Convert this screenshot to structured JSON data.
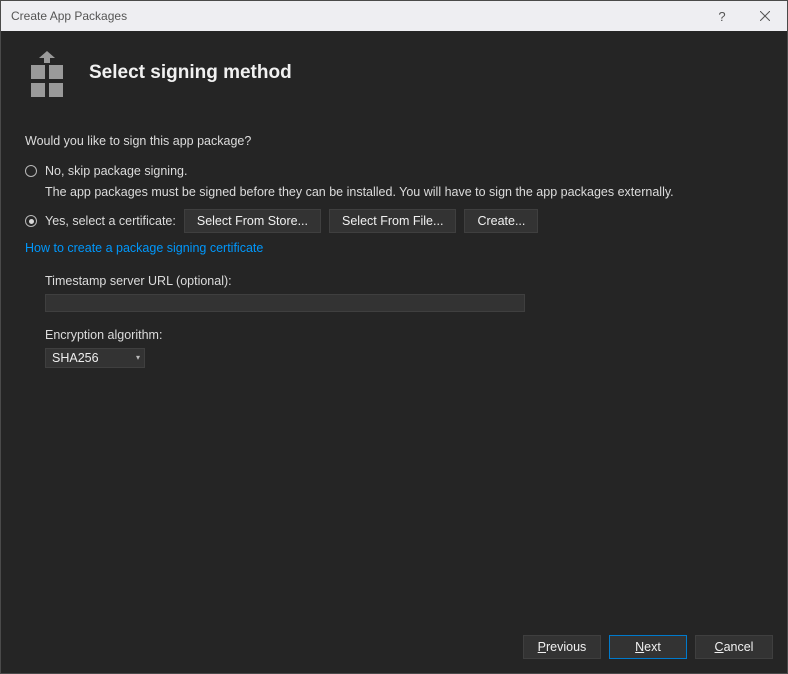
{
  "window": {
    "title": "Create App Packages"
  },
  "header": {
    "title": "Select signing method"
  },
  "prompt": "Would you like to sign this app package?",
  "options": {
    "no_label": "No, skip package signing.",
    "no_subtext": "The app packages must be signed before they can be installed. You will have to sign the app packages externally.",
    "yes_label": "Yes, select a certificate:",
    "select_store": "Select From Store...",
    "select_file": "Select From File...",
    "create": "Create..."
  },
  "link": "How to create a package signing certificate",
  "timestamp": {
    "label": "Timestamp server URL (optional):",
    "value": ""
  },
  "encryption": {
    "label": "Encryption algorithm:",
    "value": "SHA256"
  },
  "buttons": {
    "previous": "Previous",
    "previous_mnemonic": "P",
    "next": "Next",
    "next_mnemonic": "N",
    "cancel": "Cancel",
    "cancel_mnemonic": "C"
  }
}
